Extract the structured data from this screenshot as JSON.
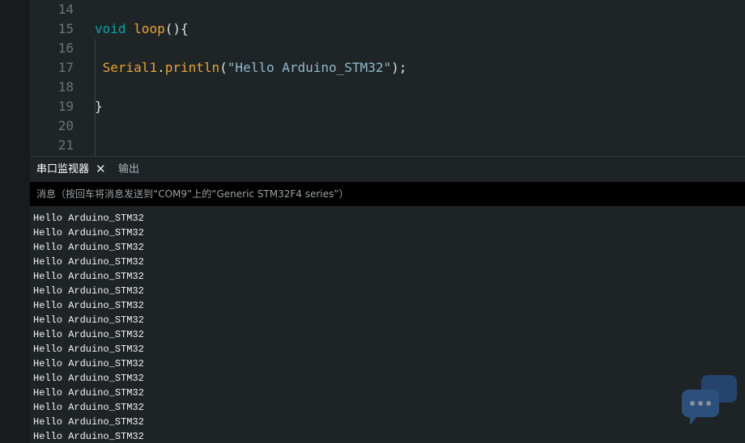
{
  "editor": {
    "lines": [
      {
        "num": "14",
        "tokens": []
      },
      {
        "num": "15",
        "tokens": [
          {
            "text": "void",
            "kind": "kw"
          },
          {
            "text": " ",
            "kind": "punc"
          },
          {
            "text": "loop",
            "kind": "fn"
          },
          {
            "text": "(){",
            "kind": "punc"
          }
        ]
      },
      {
        "num": "16",
        "tokens": []
      },
      {
        "num": "17",
        "tokens": [
          {
            "text": " ",
            "kind": "punc"
          },
          {
            "text": "Serial1",
            "kind": "fn"
          },
          {
            "text": ".",
            "kind": "punc"
          },
          {
            "text": "println",
            "kind": "fn"
          },
          {
            "text": "(",
            "kind": "punc"
          },
          {
            "text": "\"Hello Arduino_STM32\"",
            "kind": "str"
          },
          {
            "text": ");",
            "kind": "punc"
          }
        ]
      },
      {
        "num": "18",
        "tokens": []
      },
      {
        "num": "19",
        "tokens": [
          {
            "text": "}",
            "kind": "punc"
          }
        ]
      },
      {
        "num": "20",
        "tokens": []
      },
      {
        "num": "21",
        "tokens": []
      }
    ]
  },
  "panel": {
    "tabs": [
      {
        "label": "串口监视器",
        "active": true,
        "closable": true
      },
      {
        "label": "输出",
        "active": false,
        "closable": false
      }
    ],
    "close_glyph": "✕",
    "message_placeholder": "消息（按回车将消息发送到“COM9”上的“Generic STM32F4 series”）"
  },
  "serial_output": {
    "lines": [
      "Hello Arduino_STM32",
      "Hello Arduino_STM32",
      "Hello Arduino_STM32",
      "Hello Arduino_STM32",
      "Hello Arduino_STM32",
      "Hello Arduino_STM32",
      "Hello Arduino_STM32",
      "Hello Arduino_STM32",
      "Hello Arduino_STM32",
      "Hello Arduino_STM32",
      "Hello Arduino_STM32",
      "Hello Arduino_STM32",
      "Hello Arduino_STM32",
      "Hello Arduino_STM32",
      "Hello Arduino_STM32",
      "Hello Arduino_STM32"
    ]
  },
  "icons": {
    "chat_widget": "chat-bubbles-icon"
  },
  "colors": {
    "keyword": "#0ca1a6",
    "function": "#e8a435",
    "string": "#8fb9c9",
    "line_number": "#6b7378",
    "editor_bg": "#1f2427"
  }
}
